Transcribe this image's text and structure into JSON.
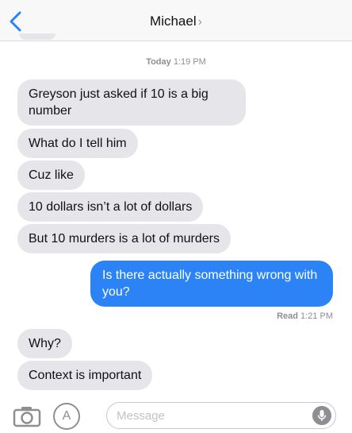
{
  "header": {
    "contact_name": "Michael",
    "chevron": "›"
  },
  "thread": {
    "timestamp_day": "Today",
    "timestamp_time": "1:19 PM",
    "messages_in_1": [
      "Greyson just asked if 10 is a big number",
      "What do I tell him",
      "Cuz like",
      "10 dollars isn’t a lot of dollars",
      "But 10 murders is a lot of murders"
    ],
    "message_out": "Is there actually something wrong with you?",
    "read_label": "Read",
    "read_time": "1:21 PM",
    "messages_in_2": [
      "Why?",
      "Context is important"
    ]
  },
  "composer": {
    "placeholder": "Message"
  },
  "icons": {
    "back": "back-chevron-icon",
    "camera": "camera-icon",
    "appstore": "app-store-icon",
    "mic": "microphone-icon"
  },
  "colors": {
    "incoming_bubble": "#e5e5ea",
    "outgoing_bubble": "#2b83f6",
    "accent": "#2b83f6"
  }
}
